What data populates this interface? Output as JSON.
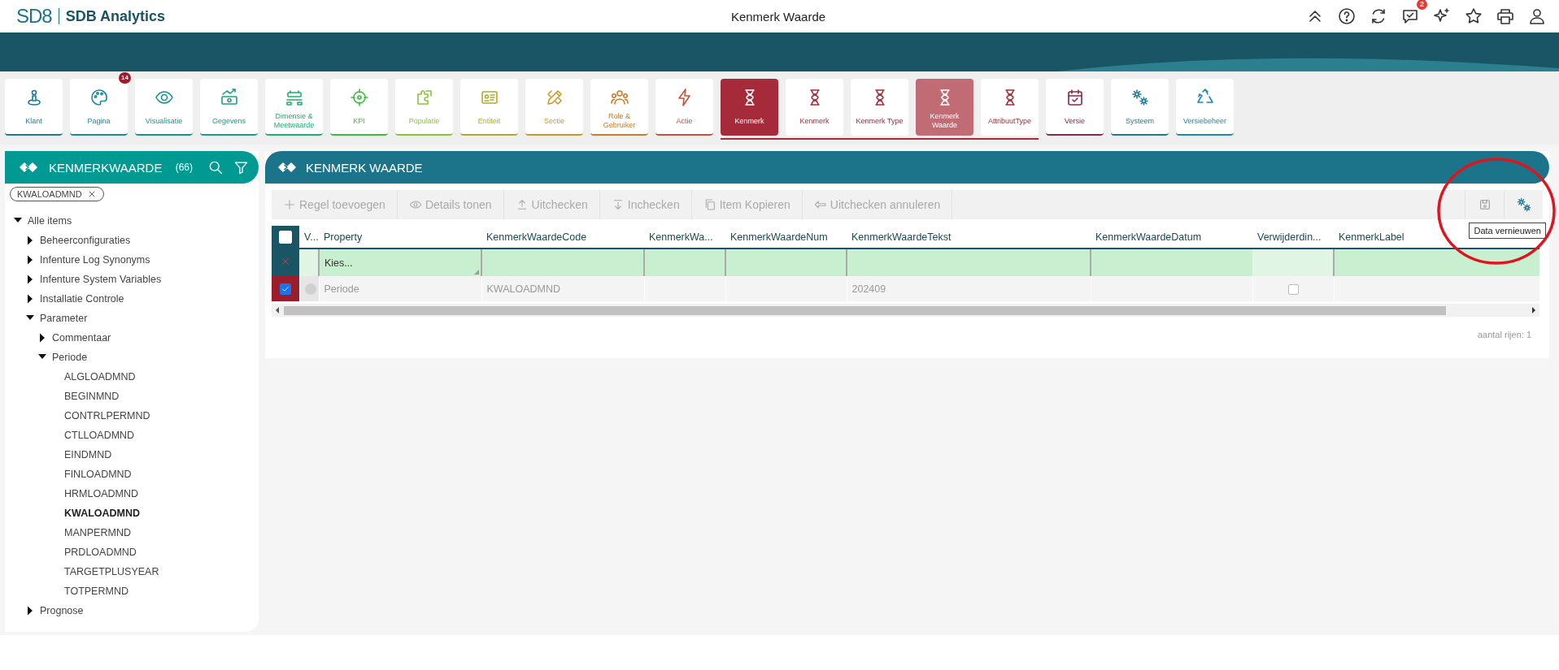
{
  "app": {
    "logo": "SD8",
    "name": "SDB Analytics",
    "title": "Kenmerk Waarde",
    "notification_count": "2"
  },
  "nav_tiles": [
    {
      "label": "Klant",
      "color": "#1b7a99",
      "selected": false
    },
    {
      "label": "Pagina",
      "color": "#1b8a9a",
      "selected": false,
      "badge": "14"
    },
    {
      "label": "Visualisatie",
      "color": "#16948f",
      "selected": false
    },
    {
      "label": "Gegevens",
      "color": "#17a085",
      "selected": false
    },
    {
      "label": "Dimensie & Meetwaarde",
      "color": "#1fae6e",
      "selected": false
    },
    {
      "label": "KPI",
      "color": "#3cbc3c",
      "selected": false
    },
    {
      "label": "Populatie",
      "color": "#8bc43a",
      "selected": false
    },
    {
      "label": "Entiteit",
      "color": "#afaa2c",
      "selected": false
    },
    {
      "label": "Sectie",
      "color": "#c99a2a",
      "selected": false
    },
    {
      "label": "Role & Gebruiker",
      "color": "#d07a2a",
      "selected": false
    },
    {
      "label": "Actie",
      "color": "#c9503a",
      "selected": false
    },
    {
      "label": "Kenmerk",
      "color": "#a62b3a",
      "selected": false,
      "expanded": true,
      "children": [
        {
          "label": "Kenmerk",
          "selected": false
        },
        {
          "label": "Kenmerk Type",
          "selected": false
        },
        {
          "label": "Kenmerk Waarde",
          "selected": true
        },
        {
          "label": "AttribuutType",
          "selected": false
        }
      ]
    },
    {
      "label": "Versie",
      "color": "#8a2846",
      "selected": false
    },
    {
      "label": "Systeem",
      "color": "#1b7a99",
      "selected": false
    },
    {
      "label": "Versiebeheer",
      "color": "#1b8ab0",
      "selected": false
    }
  ],
  "sidebar": {
    "title": "KENMERKWAARDE",
    "count": "(66)",
    "filter_chip": "KWALOADMND",
    "tree": [
      {
        "label": "Alle items",
        "expanded": true,
        "children": [
          {
            "label": "Beheerconfiguraties",
            "expanded": false
          },
          {
            "label": "Infenture Log Synonyms",
            "expanded": false
          },
          {
            "label": "Infenture System Variables",
            "expanded": false
          },
          {
            "label": "Installatie Controle",
            "expanded": false
          },
          {
            "label": "Parameter",
            "expanded": true,
            "children": [
              {
                "label": "Commentaar",
                "expanded": false
              },
              {
                "label": "Periode",
                "expanded": true,
                "children": [
                  {
                    "label": "ALGLOADMND",
                    "selected": false
                  },
                  {
                    "label": "BEGINMND",
                    "selected": false
                  },
                  {
                    "label": "CONTRLPERMND",
                    "selected": false
                  },
                  {
                    "label": "CTLLOADMND",
                    "selected": false
                  },
                  {
                    "label": "EINDMND",
                    "selected": false
                  },
                  {
                    "label": "FINLOADMND",
                    "selected": false
                  },
                  {
                    "label": "HRMLOADMND",
                    "selected": false
                  },
                  {
                    "label": "KWALOADMND",
                    "selected": true
                  },
                  {
                    "label": "MANPERMND",
                    "selected": false
                  },
                  {
                    "label": "PRDLOADMND",
                    "selected": false
                  },
                  {
                    "label": "TARGETPLUSYEAR",
                    "selected": false
                  },
                  {
                    "label": "TOTPERMND",
                    "selected": false
                  }
                ]
              }
            ]
          },
          {
            "label": "Prognose",
            "expanded": false
          }
        ]
      }
    ]
  },
  "main": {
    "title": "KENMERK WAARDE",
    "toolbar": [
      {
        "label": "Regel toevoegen",
        "disabled": true
      },
      {
        "label": "Details tonen",
        "disabled": true
      },
      {
        "label": "Uitchecken",
        "disabled": true
      },
      {
        "label": "Inchecken",
        "disabled": true
      },
      {
        "label": "Item Kopieren",
        "disabled": true
      },
      {
        "label": "Uitchecken annuleren",
        "disabled": true
      }
    ],
    "save_disabled": true,
    "tooltip": "Data vernieuwen",
    "table": {
      "all_checked": false,
      "columns": [
        {
          "label": "V...",
          "kind": "status"
        },
        {
          "label": "Property",
          "kind": "select",
          "filter": "Kies..."
        },
        {
          "label": "KenmerkWaardeCode",
          "kind": "text"
        },
        {
          "label": "KenmerkWa...",
          "kind": "text"
        },
        {
          "label": "KenmerkWaardeNum",
          "kind": "text"
        },
        {
          "label": "KenmerkWaardeTekst",
          "kind": "text"
        },
        {
          "label": "KenmerkWaardeDatum",
          "kind": "text"
        },
        {
          "label": "Verwijderdin...",
          "kind": "checkbox"
        },
        {
          "label": "KenmerkLabel",
          "kind": "text"
        }
      ],
      "rows": [
        {
          "checked": true,
          "cells": [
            null,
            "Periode",
            "KWALOADMND",
            "",
            "",
            "202409",
            "",
            false,
            ""
          ]
        }
      ]
    },
    "row_count": "aantal rijen: 1"
  }
}
